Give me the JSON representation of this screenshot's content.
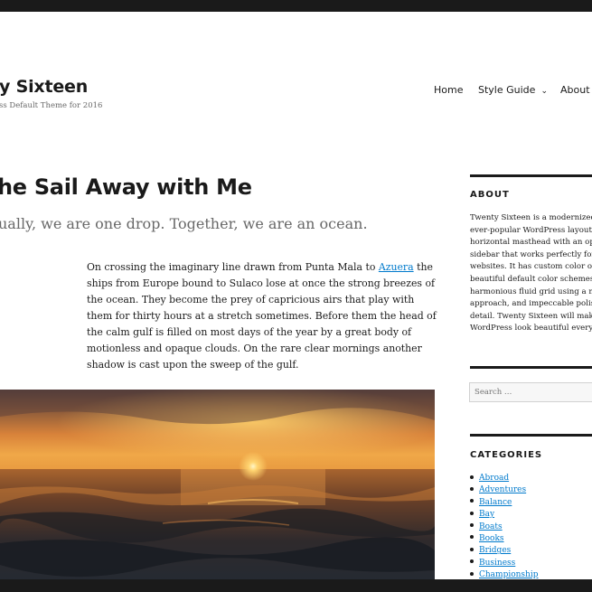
{
  "site": {
    "title": "y Sixteen",
    "description": "ss Default Theme for 2016"
  },
  "nav": {
    "items": [
      {
        "label": "Home"
      },
      {
        "label": "Style Guide",
        "chevron": "⌄"
      },
      {
        "label": "About"
      }
    ]
  },
  "post": {
    "title": "he Sail Away with Me",
    "summary": "ually, we are one drop. Together, we are an ocean.",
    "body": {
      "before_link": "On crossing the imaginary line drawn from Punta Mala to ",
      "link_text": "Azuera",
      "after_link": " the ships from Europe bound to Sulaco lose at once the strong breezes of the ocean. They become the prey of capricious airs that play with them for thirty hours at a stretch sometimes. Before them the head of the calm gulf is filled on most days of the year by a great body of motionless and opaque clouds. On the rare clear mornings another shadow is cast upon the sweep of the gulf."
    },
    "image_subject": "sunset over ocean waves"
  },
  "sidebar": {
    "about": {
      "title": "ABOUT",
      "lines": [
        "Twenty Sixteen is a modernized t",
        "ever-popular WordPress layout —",
        "horizontal masthead with an opt",
        "sidebar that works perfectly for b",
        "websites. It has custom color opt",
        "beautiful default color schemes,",
        "harmonious fluid grid using a mo",
        "approach, and impeccable polish",
        "detail. Twenty Sixteen will make",
        "WordPress look beautiful everyw"
      ]
    },
    "search": {
      "placeholder": "Search …"
    },
    "categories": {
      "title": "CATEGORIES",
      "items": [
        "Abroad",
        "Adventures",
        "Balance",
        "Bay",
        "Boats",
        "Books",
        "Bridges",
        "Business",
        "Championship"
      ]
    }
  },
  "colors": {
    "link": "#007acc",
    "text": "#1a1a1a",
    "muted": "#686868",
    "frame": "#1a1a1a"
  }
}
